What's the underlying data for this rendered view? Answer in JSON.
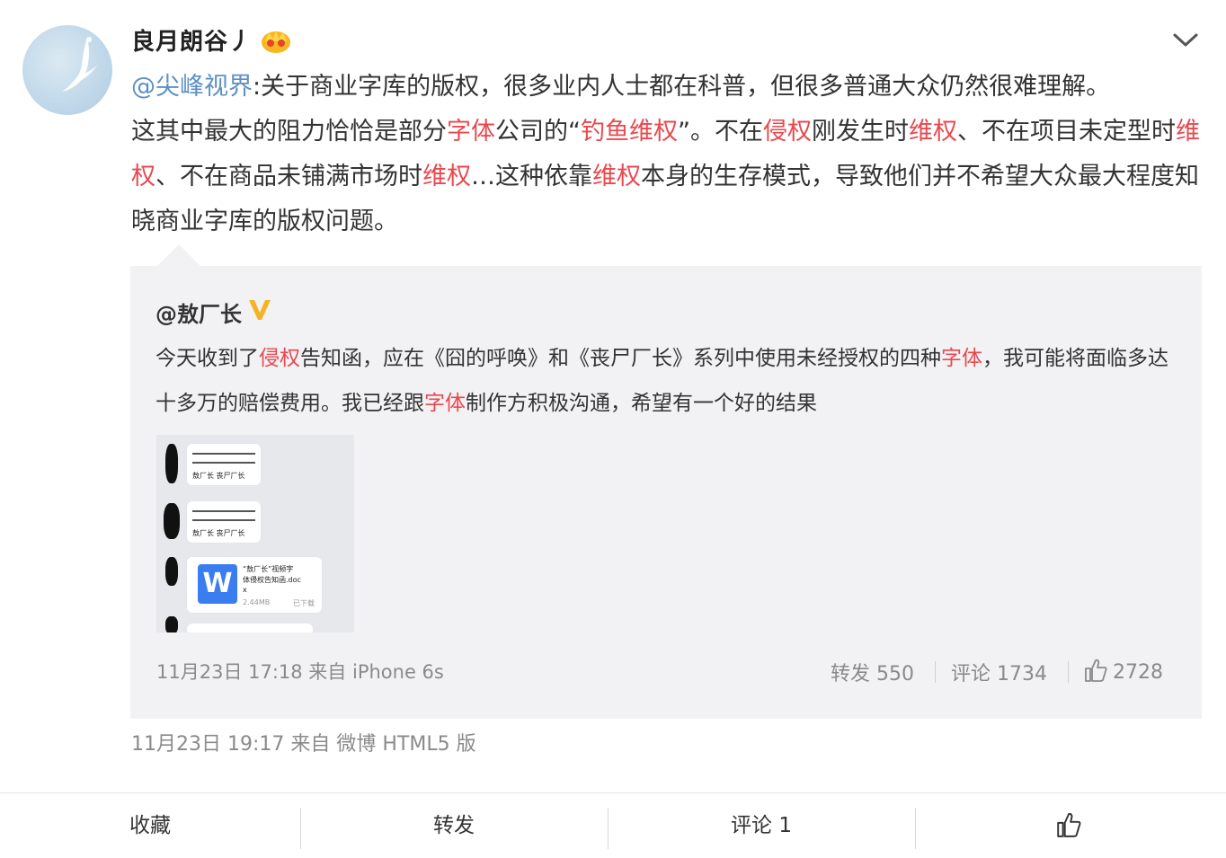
{
  "post": {
    "username": "良月朗谷丿",
    "segments": [
      {
        "text": "@尖峰视界",
        "type": "mention"
      },
      {
        "text": ":关于商业字库的版权，很多业内人士都在科普，但很多普通大众仍然很难理解。",
        "type": "text"
      },
      {
        "text": "这其中最大的阻力恰恰是部分",
        "type": "text"
      },
      {
        "text": "字体",
        "type": "kw"
      },
      {
        "text": "公司的“",
        "type": "text"
      },
      {
        "text": "钓鱼维权",
        "type": "kw"
      },
      {
        "text": "”。不在",
        "type": "text"
      },
      {
        "text": "侵权",
        "type": "kw"
      },
      {
        "text": "刚发生时",
        "type": "text"
      },
      {
        "text": "维权",
        "type": "kw"
      },
      {
        "text": "、不在项目未定型时",
        "type": "text"
      },
      {
        "text": "维权",
        "type": "kw"
      },
      {
        "text": "、不在商品未铺满市场时",
        "type": "text"
      },
      {
        "text": "维权",
        "type": "kw"
      },
      {
        "text": "…这种依靠",
        "type": "text"
      },
      {
        "text": "维权",
        "type": "kw"
      },
      {
        "text": "本身的生存模式，导致他们并不希望大众最大程度知晓商业字库的版权问题。",
        "type": "text"
      }
    ],
    "meta": "11月23日 19:17 来自 微博 HTML5 版"
  },
  "quote": {
    "username": "@敖厂长",
    "segments": [
      {
        "text": "今天收到了",
        "type": "text"
      },
      {
        "text": "侵权",
        "type": "kw"
      },
      {
        "text": "告知函，应在《囧的呼唤》和《丧尸厂长》系列中使用未经授权的四种",
        "type": "text"
      },
      {
        "text": "字体",
        "type": "kw"
      },
      {
        "text": "，我可能将面临多达十多万的赔偿费用。我已经跟",
        "type": "text"
      },
      {
        "text": "字体",
        "type": "kw"
      },
      {
        "text": "制作方积极沟通，希望有一个好的结果",
        "type": "text"
      }
    ],
    "meta": "11月23日 17:18 来自 iPhone 6s",
    "repost_label": "转发 550",
    "comment_label": "评论 1734",
    "like_count": "2728",
    "thumb": {
      "chat1": "敖厂长  丧尸厂长",
      "chat2": "敖厂长  丧尸厂长",
      "doc_name_1": "“敖厂长”视频字",
      "doc_name_2": "体侵权告知函.doc",
      "doc_name_3": "x",
      "doc_size": "2.44MB",
      "doc_status": "已下载",
      "doc_icon": "W"
    }
  },
  "toolbar": {
    "favorite": "收藏",
    "repost": "转发",
    "comment": "评论 1"
  },
  "colors": {
    "mention": "#5d8fc6",
    "keyword": "#e8494f",
    "quote_bg": "#f2f2f4",
    "meta": "#8a8a8a"
  },
  "icons": [
    "crown-icon",
    "chevron-down-icon",
    "verified-v-icon",
    "thumbs-up-icon"
  ]
}
